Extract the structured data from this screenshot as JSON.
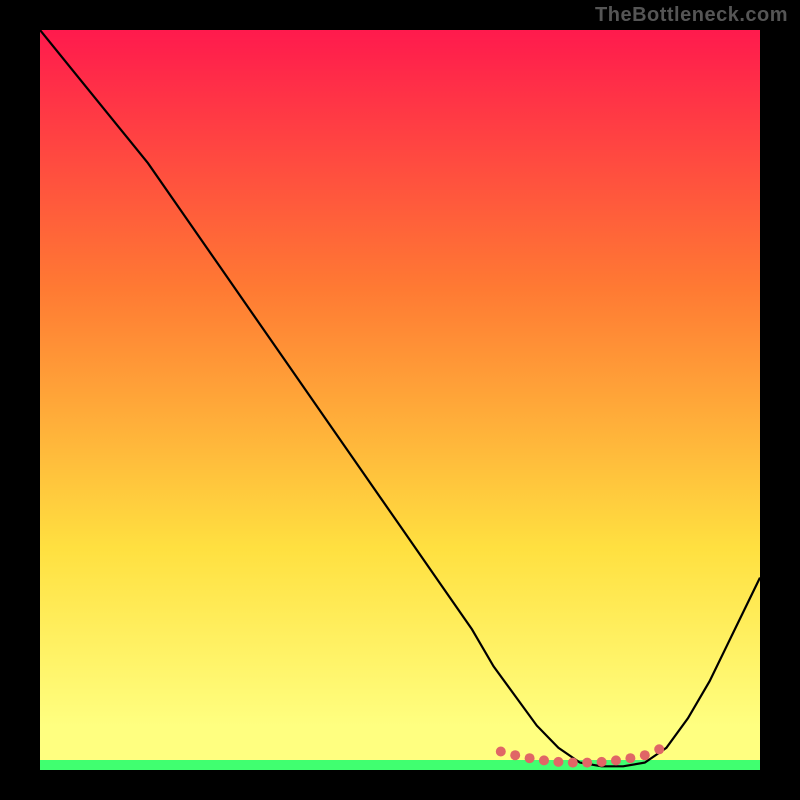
{
  "watermark": "TheBottleneck.com",
  "chart_data": {
    "type": "line",
    "title": "",
    "xlabel": "",
    "ylabel": "",
    "xlim": [
      0,
      100
    ],
    "ylim": [
      0,
      100
    ],
    "gradient": {
      "top": "#ff1a4d",
      "mid1": "#ff7a33",
      "mid2": "#ffe040",
      "bottom_band": "#ffff80",
      "bottom_line": "#40ff70"
    },
    "series": [
      {
        "name": "curve",
        "x": [
          0,
          5,
          10,
          15,
          20,
          25,
          30,
          35,
          40,
          45,
          50,
          55,
          60,
          63,
          66,
          69,
          72,
          75,
          78,
          81,
          84,
          87,
          90,
          93,
          96,
          100
        ],
        "y": [
          100,
          94,
          88,
          82,
          75,
          68,
          61,
          54,
          47,
          40,
          33,
          26,
          19,
          14,
          10,
          6,
          3,
          1,
          0.5,
          0.5,
          1,
          3,
          7,
          12,
          18,
          26
        ]
      }
    ],
    "markers": {
      "name": "highlight-dots",
      "color": "#e06666",
      "x": [
        64,
        66,
        68,
        70,
        72,
        74,
        76,
        78,
        80,
        82,
        84,
        86
      ],
      "y": [
        2.5,
        2.0,
        1.6,
        1.3,
        1.1,
        1.0,
        1.0,
        1.1,
        1.3,
        1.6,
        2.0,
        2.8
      ]
    }
  }
}
